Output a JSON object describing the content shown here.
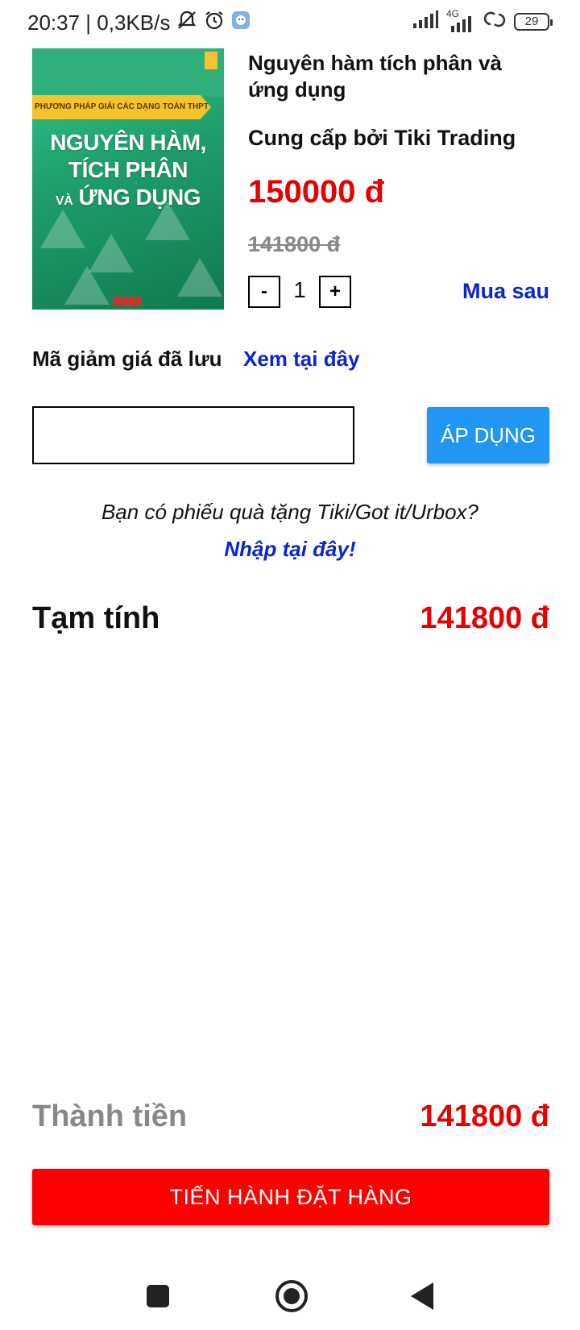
{
  "status_bar": {
    "time_speed": "20:37 | 0,3KB/s",
    "network": "4G",
    "battery": "29"
  },
  "product": {
    "cover": {
      "band_text": "PHƯƠNG PHÁP GIẢI CÁC DẠNG TOÁN THPT",
      "title_line1": "NGUYÊN HÀM,",
      "title_line2": "TÍCH PHÂN",
      "title_line3_small": "VÀ",
      "title_line3": "ỨNG DỤNG"
    },
    "title": "Nguyên hàm tích phân và ứng dụng",
    "seller": "Cung cấp bởi Tiki Trading",
    "price": "150000 đ",
    "old_price": "141800 đ",
    "quantity": {
      "minus": "-",
      "value": "1",
      "plus": "+"
    },
    "buy_later": "Mua sau"
  },
  "coupon": {
    "saved_label": "Mã giảm giá đã lưu",
    "saved_link": "Xem tại đây",
    "input_value": "",
    "apply_label": "ÁP DỤNG"
  },
  "gift": {
    "question": "Bạn có phiếu quà tặng Tiki/Got it/Urbox?",
    "link": "Nhập tại đây!"
  },
  "summary": {
    "subtotal_label": "Tạm tính",
    "subtotal_value": "141800 đ",
    "total_label": "Thành tiền",
    "total_value": "141800 đ"
  },
  "checkout_label": "TIẾN HÀNH ĐẶT HÀNG",
  "colors": {
    "price_red": "#e60000",
    "link_blue": "#0a25d0",
    "apply_blue": "#2196f3",
    "checkout_red": "#ff0000"
  }
}
